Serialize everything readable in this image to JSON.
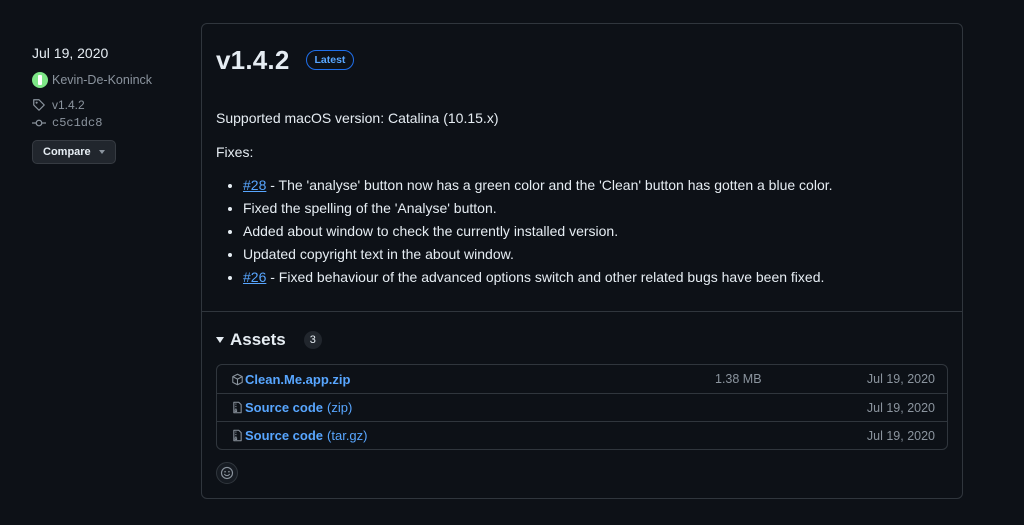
{
  "sidebar": {
    "date": "Jul 19, 2020",
    "author": "Kevin-De-Koninck",
    "tag": "v1.4.2",
    "commit": "c5c1dc8",
    "compare_label": "Compare"
  },
  "release": {
    "title": "v1.4.2",
    "badge": "Latest",
    "description": "Supported macOS version: Catalina (10.15.x)",
    "fixes_label": "Fixes:",
    "fixes": [
      {
        "link": "#28",
        "text": " - The 'analyse' button now has a green color and the 'Clean' button has gotten a blue color."
      },
      {
        "link": "",
        "text": "Fixed the spelling of the 'Analyse' button."
      },
      {
        "link": "",
        "text": "Added about window to check the currently installed version."
      },
      {
        "link": "",
        "text": "Updated copyright text in the about window."
      },
      {
        "link": "#26",
        "text": " - Fixed behaviour of the advanced options switch and other related bugs have been fixed."
      }
    ]
  },
  "assets": {
    "title": "Assets",
    "count": "3",
    "items": [
      {
        "icon": "package-icon",
        "name": "Clean.Me.app.zip",
        "ext": "",
        "size": "1.38 MB",
        "date": "Jul 19, 2020"
      },
      {
        "icon": "file-zip-icon",
        "name": "Source code",
        "ext": "(zip)",
        "size": "",
        "date": "Jul 19, 2020"
      },
      {
        "icon": "file-zip-icon",
        "name": "Source code",
        "ext": "(tar.gz)",
        "size": "",
        "date": "Jul 19, 2020"
      }
    ]
  },
  "colors": {
    "background": "#0d1117",
    "border": "#30363d",
    "link": "#58a6ff",
    "muted": "#8b949e"
  }
}
